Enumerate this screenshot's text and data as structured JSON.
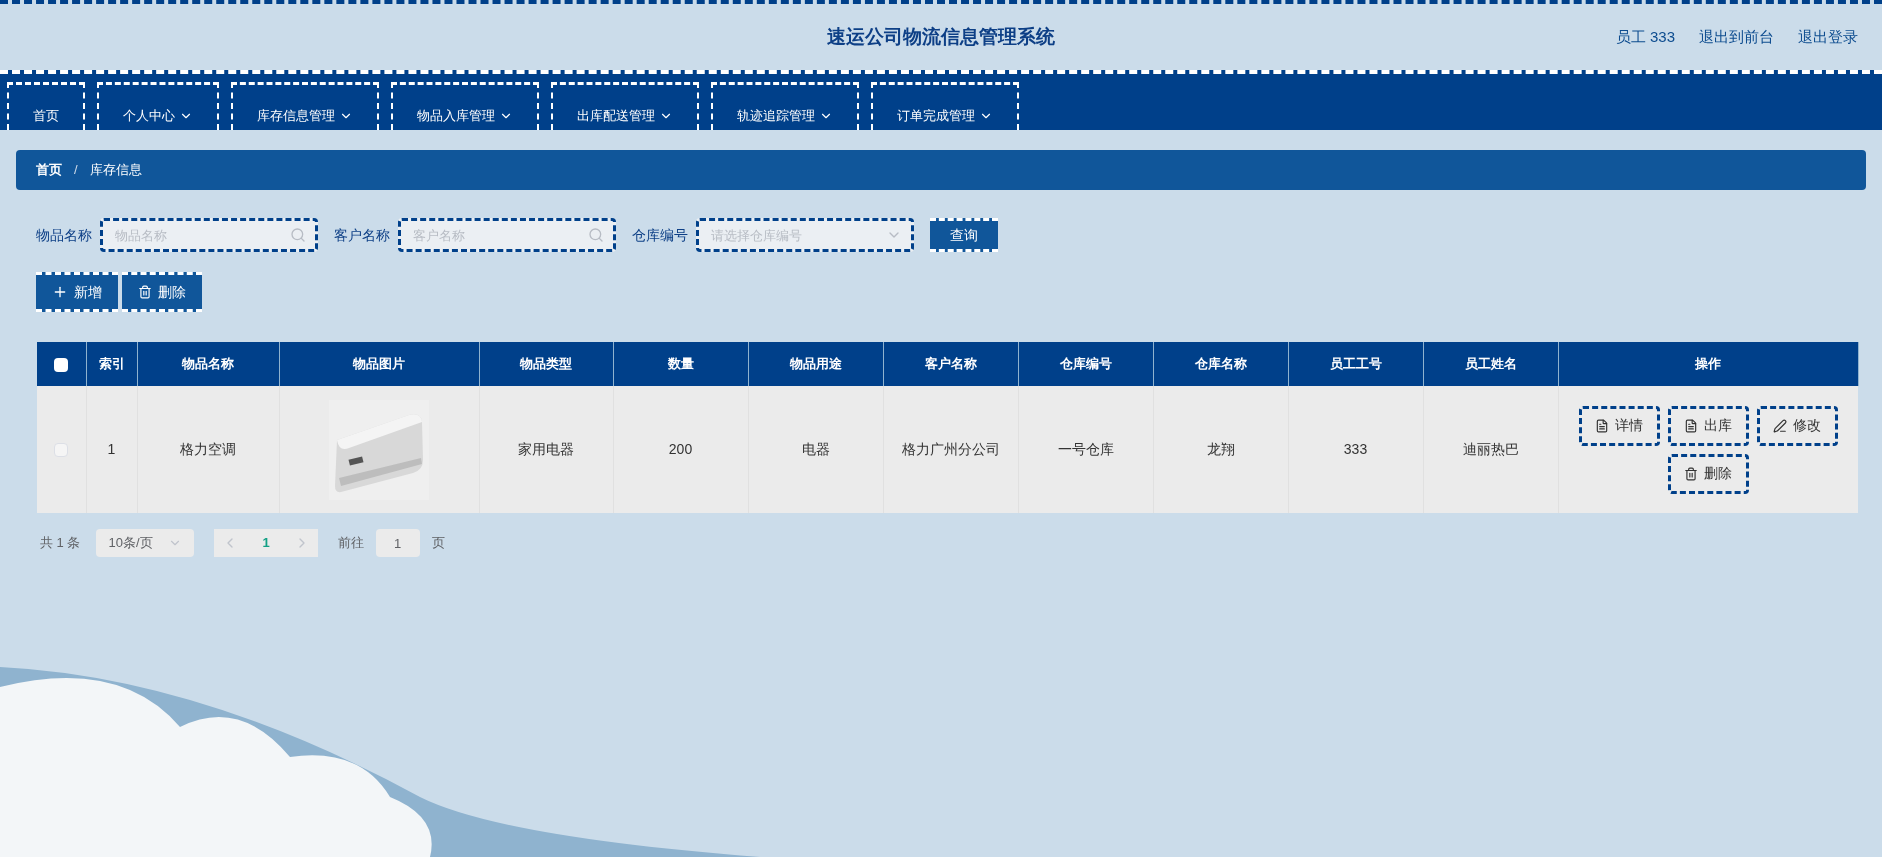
{
  "header": {
    "title": "速运公司物流信息管理系统",
    "user": "员工 333",
    "links": [
      "退出到前台",
      "退出登录"
    ]
  },
  "nav": [
    {
      "label": "首页",
      "dropdown": false,
      "selected": false
    },
    {
      "label": "个人中心",
      "dropdown": true,
      "selected": false
    },
    {
      "label": "库存信息管理",
      "dropdown": true,
      "selected": false
    },
    {
      "label": "物品入库管理",
      "dropdown": true,
      "selected": false
    },
    {
      "label": "出库配送管理",
      "dropdown": true,
      "selected": false
    },
    {
      "label": "轨迹追踪管理",
      "dropdown": true,
      "selected": false
    },
    {
      "label": "订单完成管理",
      "dropdown": true,
      "selected": false
    }
  ],
  "breadcrumb": {
    "items": [
      "首页",
      "库存信息"
    ],
    "separator": "/"
  },
  "filters": [
    {
      "kind": "search",
      "label": "物品名称",
      "placeholder": "物品名称"
    },
    {
      "kind": "search",
      "label": "客户名称",
      "placeholder": "客户名称"
    },
    {
      "kind": "select",
      "label": "仓库编号",
      "placeholder": "请选择仓库编号"
    }
  ],
  "query_button": "查询",
  "actions": [
    {
      "kind": "add",
      "label": "新增"
    },
    {
      "kind": "delete",
      "label": "删除"
    }
  ],
  "table": {
    "select_all_checked": false,
    "columns": [
      "索引",
      "物品名称",
      "物品图片",
      "物品类型",
      "数量",
      "物品用途",
      "客户名称",
      "仓库编号",
      "仓库名称",
      "员工工号",
      "员工姓名",
      "操作"
    ],
    "rows": [
      {
        "checked": false,
        "cells": [
          "1",
          "格力空调",
          {
            "kind": "picture"
          },
          "家用电器",
          "200",
          "电器",
          "格力广州分公司",
          "一号仓库",
          "龙翔",
          "333",
          "迪丽热巴"
        ],
        "buttons": [
          {
            "kind": "doc",
            "label": "详情"
          },
          {
            "kind": "doc",
            "label": "出库"
          },
          {
            "kind": "edit",
            "label": "修改"
          },
          {
            "kind": "delete",
            "label": "删除"
          }
        ]
      }
    ]
  },
  "pagination": {
    "total": "共 1 条",
    "page_size": "10条/页",
    "pages": [
      {
        "label": "1",
        "selected": true
      }
    ],
    "goto_label": "前往",
    "goto_value": "1",
    "goto_suffix": "页"
  }
}
